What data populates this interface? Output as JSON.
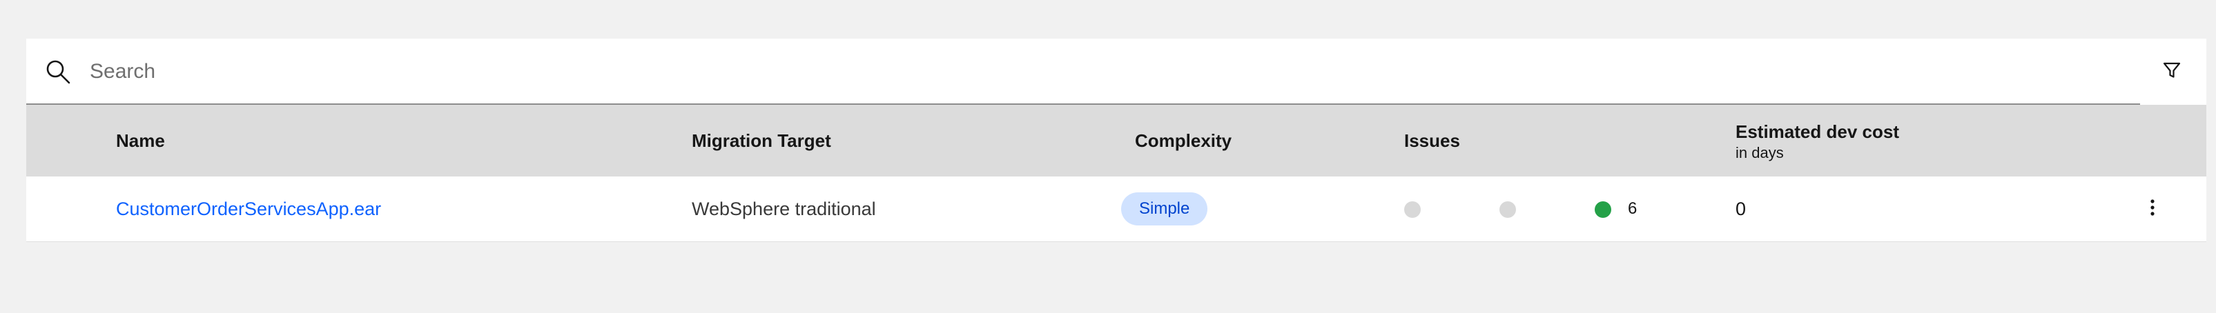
{
  "search": {
    "placeholder": "Search",
    "value": "",
    "icon": "search-icon"
  },
  "toolbar": {
    "filter_icon": "filter-icon"
  },
  "table": {
    "columns": {
      "name": "Name",
      "migration_target": "Migration Target",
      "complexity": "Complexity",
      "issues": "Issues",
      "dev_cost": "Estimated dev cost",
      "dev_cost_unit": "in days"
    },
    "rows": [
      {
        "name": "CustomerOrderServicesApp.ear",
        "migration_target": "WebSphere traditional",
        "complexity": "Simple",
        "issues": {
          "severe": "",
          "warning": "",
          "info": "6"
        },
        "dev_cost": "0",
        "overflow_icon": "overflow-menu-icon"
      }
    ]
  },
  "colors": {
    "link": "#0f62fe",
    "tag_background": "#d0e2ff",
    "tag_text": "#0043ce",
    "issue_inactive": "#d8d8d8",
    "issue_info": "#24a148",
    "header_background": "#dcdcdc"
  }
}
